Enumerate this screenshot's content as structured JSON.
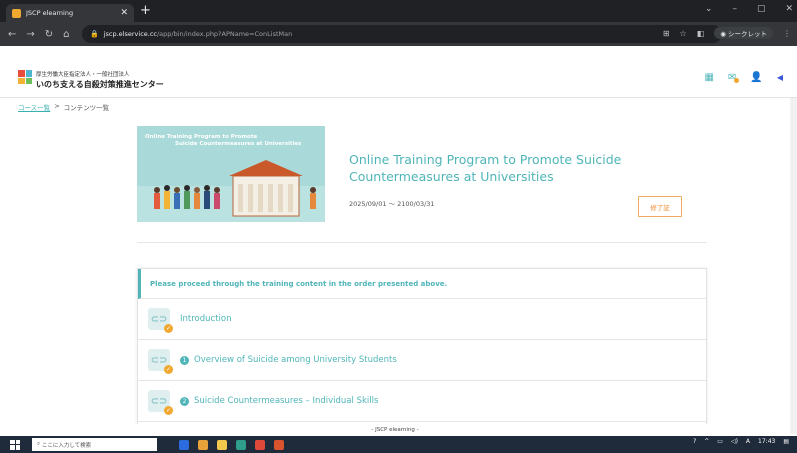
{
  "browser": {
    "tab_title": "JSCP elearning",
    "tab_close": "✕",
    "new_tab": "+",
    "window_controls": [
      "⌄",
      "–",
      "▢",
      "✕"
    ],
    "url_host": "jscp.elservice.cc",
    "url_path": "/app/bin/index.php?APName=ConListMan",
    "incognito_label": "シークレット"
  },
  "header": {
    "org_subtitle": "厚生労働大臣指定法人・一般社団法人",
    "org_name": "いのち支える自殺対策推進センター"
  },
  "breadcrumb": {
    "items": [
      "コース一覧",
      "コンテンツ一覧"
    ],
    "separator": ">"
  },
  "course": {
    "banner_line1": "Online Training Program to Promote",
    "banner_line2": "Suicide Countermeasures at Universities",
    "title": "Online Training Program to Promote Suicide Countermeasures at Universities",
    "period": "2025/09/01 〜 2100/03/31",
    "certificate_label": "修了証"
  },
  "content_list": {
    "instruction": "Please proceed through the training content in the order presented above.",
    "items": [
      {
        "number": "",
        "label": "Introduction"
      },
      {
        "number": "1",
        "label": "Overview of Suicide among University Students"
      },
      {
        "number": "2",
        "label": "Suicide Countermeasures – Individual Skills"
      }
    ]
  },
  "footer": {
    "text": "- JSCP elearning -"
  },
  "taskbar": {
    "search_placeholder": "ここに入力して検索",
    "time": "17:43"
  },
  "colors": {
    "accent": "#4fb5b8",
    "orange": "#f0a830"
  }
}
